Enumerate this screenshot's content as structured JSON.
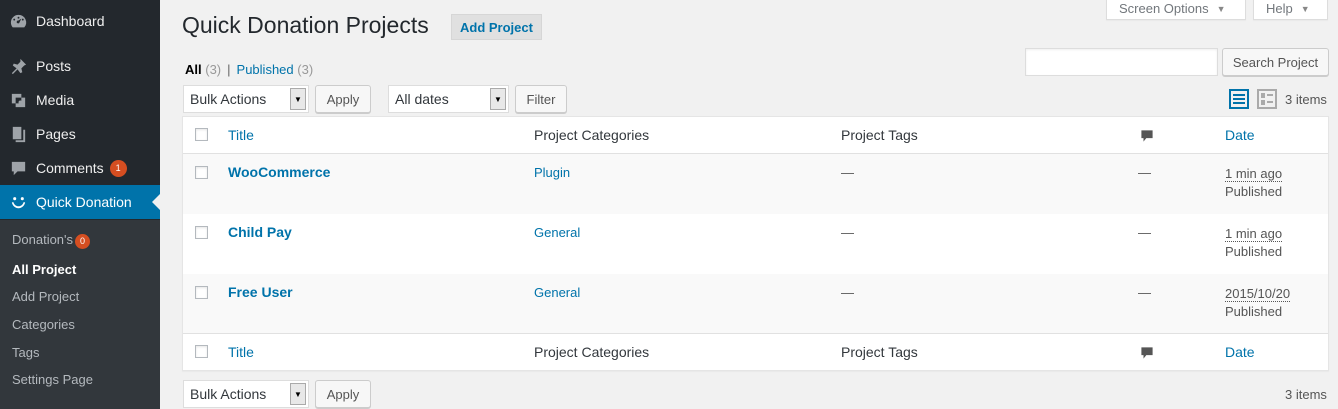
{
  "sidebar": {
    "items": [
      {
        "label": "Dashboard",
        "icon": "dashboard-icon"
      },
      {
        "label": "Posts",
        "icon": "pushpin-icon"
      },
      {
        "label": "Media",
        "icon": "media-icon"
      },
      {
        "label": "Pages",
        "icon": "pages-icon"
      },
      {
        "label": "Comments",
        "icon": "comments-icon",
        "badge": "1"
      },
      {
        "label": "Quick Donation",
        "icon": "smiley-icon"
      }
    ],
    "submenu": [
      {
        "label": "Donation's",
        "badge": "0"
      },
      {
        "label": "All Project"
      },
      {
        "label": "Add Project"
      },
      {
        "label": "Categories"
      },
      {
        "label": "Tags"
      },
      {
        "label": "Settings Page"
      }
    ]
  },
  "top_tabs": {
    "screen_options": "Screen Options",
    "help": "Help"
  },
  "header": {
    "title": "Quick Donation Projects",
    "add_button": "Add Project"
  },
  "filters": {
    "all_label": "All",
    "all_count": "(3)",
    "separator": "|",
    "published_label": "Published",
    "published_count": "(3)"
  },
  "search": {
    "button": "Search Project"
  },
  "toolbar": {
    "bulk_actions": "Bulk Actions",
    "apply": "Apply",
    "dates": "All dates",
    "filter": "Filter",
    "items_count": "3 items"
  },
  "table": {
    "columns": {
      "title": "Title",
      "categories": "Project Categories",
      "tags": "Project Tags",
      "date": "Date"
    },
    "rows": [
      {
        "title": "WooCommerce",
        "category": "Plugin",
        "tags": "—",
        "comments": "—",
        "date": "1 min ago",
        "status": "Published"
      },
      {
        "title": "Child Pay",
        "category": "General",
        "tags": "—",
        "comments": "—",
        "date": "1 min ago",
        "status": "Published"
      },
      {
        "title": "Free User",
        "category": "General",
        "tags": "—",
        "comments": "—",
        "date": "2015/10/20",
        "status": "Published"
      }
    ]
  },
  "colors": {
    "sidebar_bg": "#23282d",
    "active": "#0073aa",
    "link": "#0073aa",
    "badge": "#d54e21"
  }
}
